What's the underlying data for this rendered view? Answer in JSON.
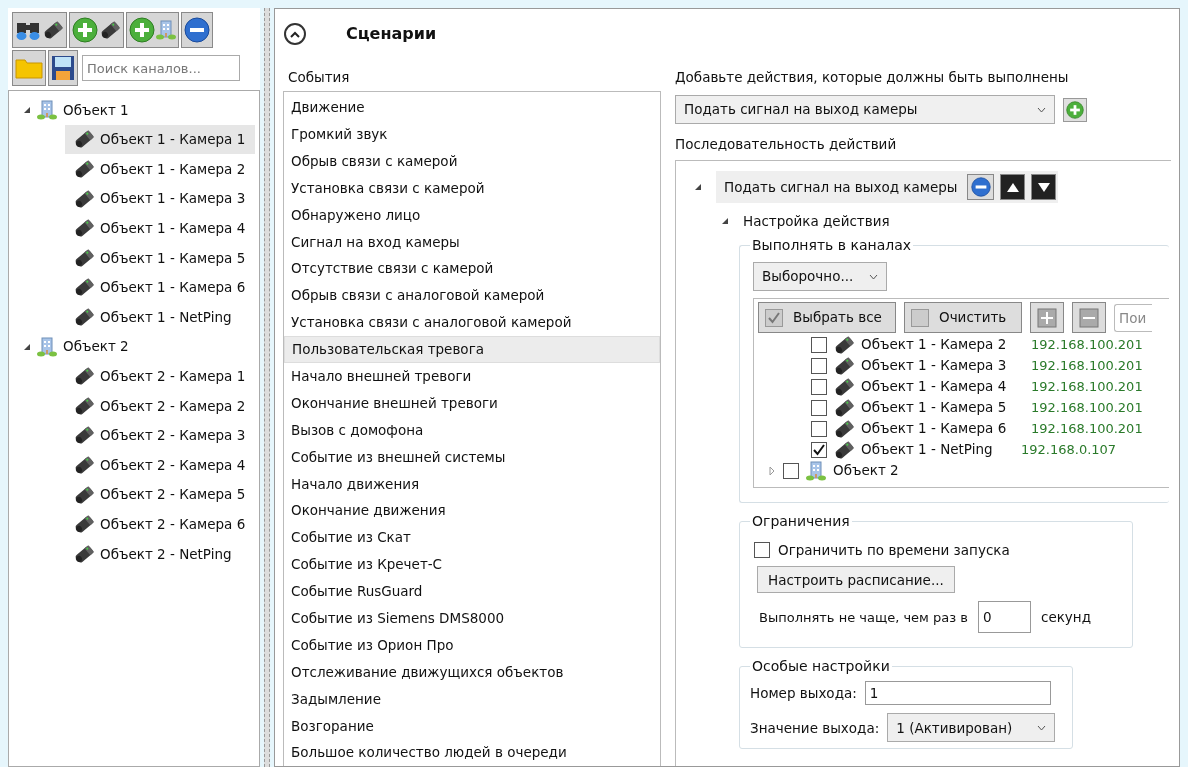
{
  "sidebar": {
    "search": {
      "placeholder": "Поиск каналов..."
    },
    "tree": [
      {
        "label": "Объект 1",
        "kind": "object",
        "expanded": true,
        "selected": false,
        "children": [
          {
            "label": "Объект 1 - Камера 1",
            "kind": "camera",
            "selected": true
          },
          {
            "label": "Объект 1 - Камера 2",
            "kind": "camera",
            "selected": false
          },
          {
            "label": "Объект 1 - Камера 3",
            "kind": "camera",
            "selected": false
          },
          {
            "label": "Объект 1 - Камера 4",
            "kind": "camera",
            "selected": false
          },
          {
            "label": "Объект 1 - Камера 5",
            "kind": "camera",
            "selected": false
          },
          {
            "label": "Объект 1 - Камера 6",
            "kind": "camera",
            "selected": false
          },
          {
            "label": "Объект 1 - NetPing",
            "kind": "camera",
            "selected": false
          }
        ]
      },
      {
        "label": "Объект 2",
        "kind": "object",
        "expanded": true,
        "selected": false,
        "children": [
          {
            "label": "Объект 2 - Камера 1",
            "kind": "camera",
            "selected": false
          },
          {
            "label": "Объект 2 - Камера 2",
            "kind": "camera",
            "selected": false
          },
          {
            "label": "Объект 2 - Камера 3",
            "kind": "camera",
            "selected": false
          },
          {
            "label": "Объект 2 - Камера 4",
            "kind": "camera",
            "selected": false
          },
          {
            "label": "Объект 2 - Камера 5",
            "kind": "camera",
            "selected": false
          },
          {
            "label": "Объект 2 - Камера 6",
            "kind": "camera",
            "selected": false
          },
          {
            "label": "Объект 2 - NetPing",
            "kind": "camera",
            "selected": false
          }
        ]
      }
    ]
  },
  "panel": {
    "title": "Сценарии",
    "expanded": true
  },
  "events": {
    "label": "События",
    "items": [
      {
        "label": "Движение",
        "selected": false
      },
      {
        "label": "Громкий звук",
        "selected": false
      },
      {
        "label": "Обрыв связи с камерой",
        "selected": false
      },
      {
        "label": "Установка связи с камерой",
        "selected": false
      },
      {
        "label": "Обнаружено лицо",
        "selected": false
      },
      {
        "label": "Сигнал на вход камеры",
        "selected": false
      },
      {
        "label": "Отсутствие связи с камерой",
        "selected": false
      },
      {
        "label": "Обрыв связи с аналоговой камерой",
        "selected": false
      },
      {
        "label": "Установка связи с аналоговой камерой",
        "selected": false
      },
      {
        "label": "Пользовательская тревога",
        "selected": true
      },
      {
        "label": "Начало внешней тревоги",
        "selected": false
      },
      {
        "label": "Окончание внешней тревоги",
        "selected": false
      },
      {
        "label": "Вызов с домофона",
        "selected": false
      },
      {
        "label": "Событие из внешней системы",
        "selected": false
      },
      {
        "label": "Начало движения",
        "selected": false
      },
      {
        "label": "Окончание движения",
        "selected": false
      },
      {
        "label": "Событие из Скат",
        "selected": false
      },
      {
        "label": "Событие из Кречет-С",
        "selected": false
      },
      {
        "label": "Событие RusGuard",
        "selected": false
      },
      {
        "label": "Событие из Siemens DMS8000",
        "selected": false
      },
      {
        "label": "Событие из Орион Про",
        "selected": false
      },
      {
        "label": "Отслеживание движущихся объектов",
        "selected": false
      },
      {
        "label": "Задымление",
        "selected": false
      },
      {
        "label": "Возгорание",
        "selected": false
      },
      {
        "label": "Большое количество людей в очереди",
        "selected": false
      }
    ]
  },
  "actions": {
    "add_label": "Добавьте действия, которые должны быть выполнены",
    "add_value": "Подать сигнал на выход камеры",
    "sequence_label": "Последовательность действий",
    "action": {
      "label": "Подать сигнал на выход камеры",
      "expanded": true,
      "settings_label": "Настройка действия",
      "settings_expanded": true
    },
    "channels": {
      "title": "Выполнять в каналах",
      "mode": "Выборочно...",
      "select_all": "Выбрать все",
      "clear": "Очистить",
      "search_placeholder": "Пои",
      "items": [
        {
          "kind": "camera",
          "label": "Объект 1 - Камера 2",
          "ip": "192.168.100.201",
          "checked": false
        },
        {
          "kind": "camera",
          "label": "Объект 1 - Камера 3",
          "ip": "192.168.100.201",
          "checked": false
        },
        {
          "kind": "camera",
          "label": "Объект 1 - Камера 4",
          "ip": "192.168.100.201",
          "checked": false
        },
        {
          "kind": "camera",
          "label": "Объект 1 - Камера 5",
          "ip": "192.168.100.201",
          "checked": false
        },
        {
          "kind": "camera",
          "label": "Объект 1 - Камера 6",
          "ip": "192.168.100.201",
          "checked": false
        },
        {
          "kind": "camera",
          "label": "Объект 1 - NetPing",
          "ip": "192.168.0.107",
          "checked": true
        },
        {
          "kind": "object",
          "label": "Объект 2",
          "expanded": false,
          "checked": false
        }
      ]
    },
    "limits": {
      "title": "Ограничения",
      "limit_label": "Ограничить по времени запуска",
      "limit_checked": false,
      "schedule_button": "Настроить расписание...",
      "interval_label": "Выполнять не чаще, чем раз в",
      "interval_value": "0",
      "interval_unit": "секунд"
    },
    "special": {
      "title": "Особые настройки",
      "output_label": "Номер выхода:",
      "output_value": "1",
      "value_label": "Значение выхода:",
      "value_value": "1 (Активирован)"
    }
  }
}
